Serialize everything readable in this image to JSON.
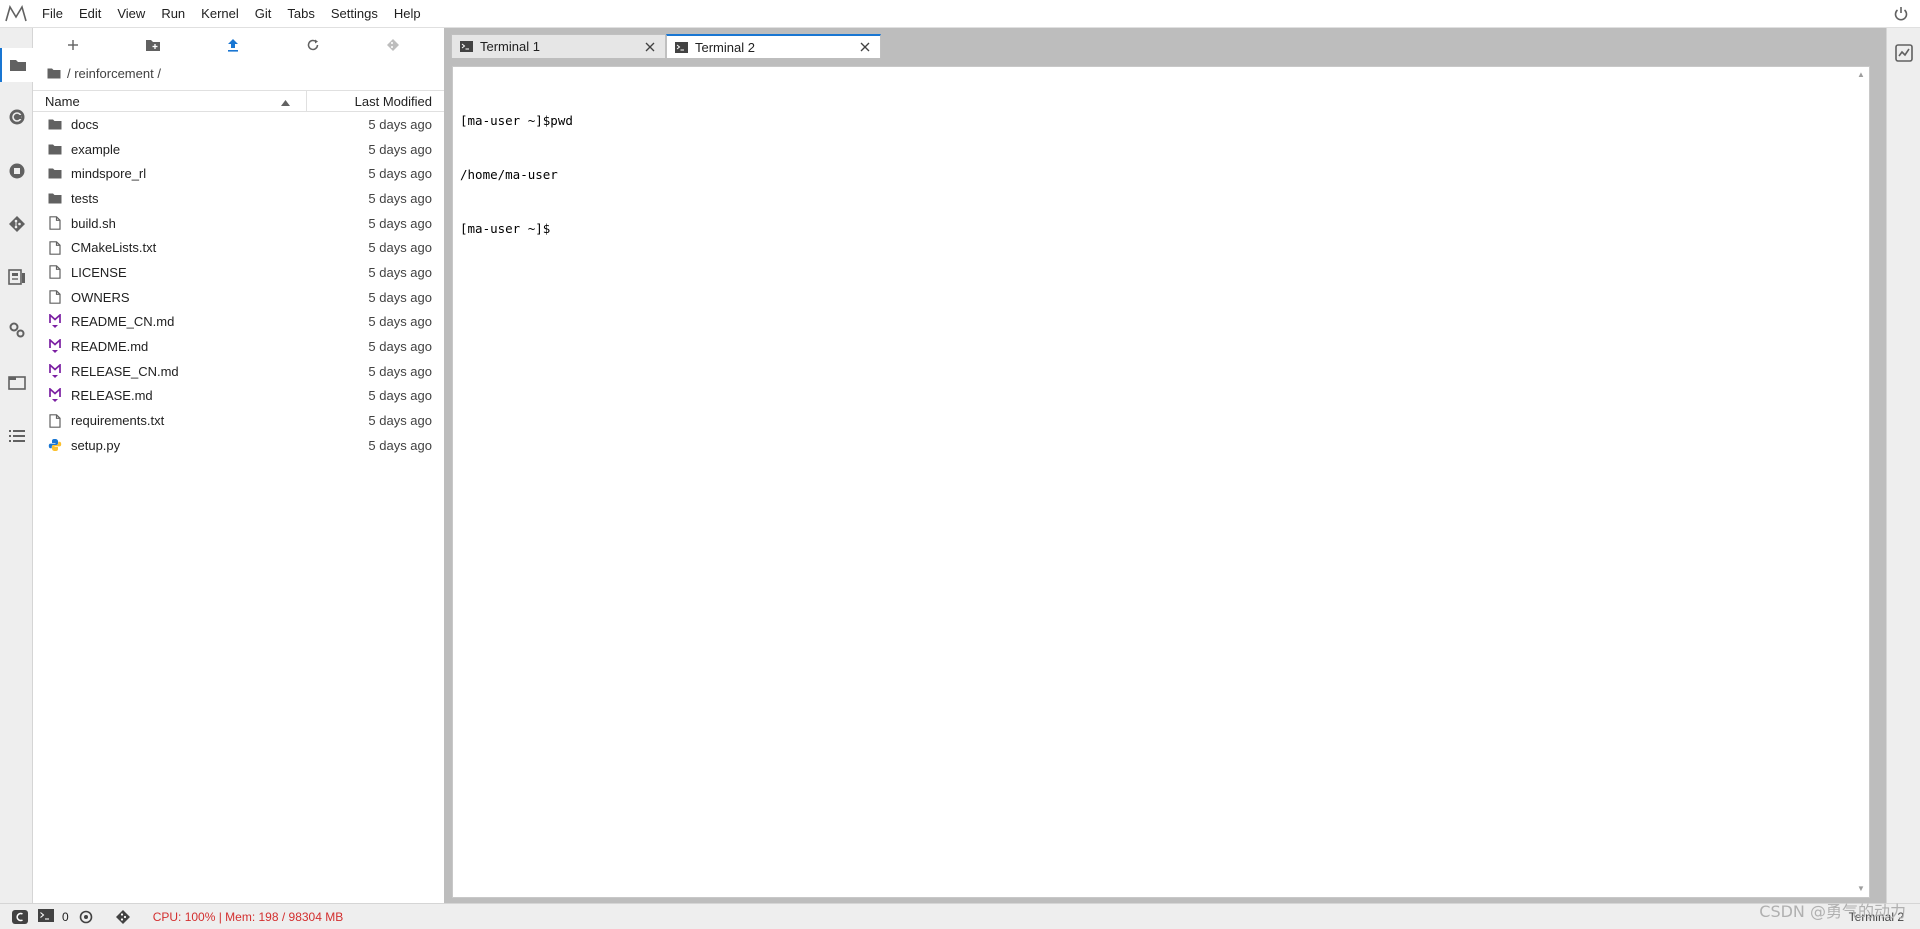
{
  "menubar": {
    "items": [
      "File",
      "Edit",
      "View",
      "Run",
      "Kernel",
      "Git",
      "Tabs",
      "Settings",
      "Help"
    ]
  },
  "leftbar": {
    "icons": [
      "folder-icon",
      "running-kernels-icon",
      "stop-circle-icon",
      "git-icon",
      "property-inspector-icon",
      "extension-manager-icon",
      "tabs-icon",
      "table-of-contents-icon"
    ]
  },
  "filebrowser": {
    "toolbar": [
      "new-launcher-icon",
      "new-folder-icon",
      "upload-icon",
      "refresh-icon",
      "git-clone-icon"
    ],
    "breadcrumb": "/ reinforcement /",
    "columns": {
      "name": "Name",
      "modified": "Last Modified"
    },
    "files": [
      {
        "name": "docs",
        "type": "folder",
        "modified": "5 days ago"
      },
      {
        "name": "example",
        "type": "folder",
        "modified": "5 days ago"
      },
      {
        "name": "mindspore_rl",
        "type": "folder",
        "modified": "5 days ago"
      },
      {
        "name": "tests",
        "type": "folder",
        "modified": "5 days ago"
      },
      {
        "name": "build.sh",
        "type": "file",
        "modified": "5 days ago"
      },
      {
        "name": "CMakeLists.txt",
        "type": "file",
        "modified": "5 days ago"
      },
      {
        "name": "LICENSE",
        "type": "file",
        "modified": "5 days ago"
      },
      {
        "name": "OWNERS",
        "type": "file",
        "modified": "5 days ago"
      },
      {
        "name": "README_CN.md",
        "type": "markdown",
        "modified": "5 days ago"
      },
      {
        "name": "README.md",
        "type": "markdown",
        "modified": "5 days ago"
      },
      {
        "name": "RELEASE_CN.md",
        "type": "markdown",
        "modified": "5 days ago"
      },
      {
        "name": "RELEASE.md",
        "type": "markdown",
        "modified": "5 days ago"
      },
      {
        "name": "requirements.txt",
        "type": "file",
        "modified": "5 days ago"
      },
      {
        "name": "setup.py",
        "type": "python",
        "modified": "5 days ago"
      }
    ]
  },
  "tabs": [
    {
      "label": "Terminal 1",
      "active": false
    },
    {
      "label": "Terminal 2",
      "active": true
    }
  ],
  "terminal": {
    "lines": [
      "[ma-user ~]$pwd",
      "/home/ma-user",
      "[ma-user ~]$"
    ]
  },
  "statusbar": {
    "terminals_count": "0",
    "resource_usage": "CPU: 100% | Mem: 198 / 98304 MB",
    "active_tab": "Terminal 2"
  },
  "watermark": "CSDN @勇气的动力",
  "colors": {
    "accent": "#1976d2",
    "markdown": "#7b1fa2",
    "python": "#1976d2",
    "cpu_warning": "#d32f2f"
  }
}
